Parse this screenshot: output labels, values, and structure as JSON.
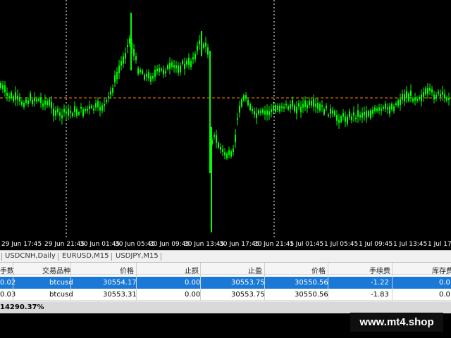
{
  "chart": {
    "candle_color": "#00ff00",
    "dotted_line_color": "#ff8000",
    "grid_color": "#ffffff",
    "price_line_level": 0.41
  },
  "time_axis": {
    "labels": [
      "29 Jun 17:45",
      "29 Jun 21:45",
      "30 Jun 01:45",
      "30 Jun 05:45",
      "30 Jun 09:45",
      "30 Jun 13:45",
      "30 Jun 17:45",
      "30 Jun 21:45",
      "1 Jul 01:45",
      "1 Jul 05:45",
      "1 Jul 09:45",
      "1 Jul 13:45",
      "1 Jul 17:45"
    ]
  },
  "tabs": [
    "USDCNH,Daily",
    "EURUSD,M15",
    "USDJPY,M15"
  ],
  "trade_table": {
    "headers": [
      "手数",
      "交易品种",
      "价格",
      "止损",
      "止盈",
      "价格",
      "手续费",
      "库存费"
    ],
    "rows": [
      {
        "lots": "0.02",
        "symbol": "btcusd",
        "price": "30554.17",
        "sl": "0.00",
        "tp": "30553.75",
        "cur_price": "30550.56",
        "commission": "-1.22",
        "swap": "0.0",
        "selected": true
      },
      {
        "lots": "0.03",
        "symbol": "btcusd",
        "price": "30553.31",
        "sl": "0.00",
        "tp": "30553.75",
        "cur_price": "30550.56",
        "commission": "-1.83",
        "swap": "0.0",
        "selected": false
      }
    ],
    "balance_line": "14290.37%"
  },
  "watermark": "www.mt4.shop"
}
